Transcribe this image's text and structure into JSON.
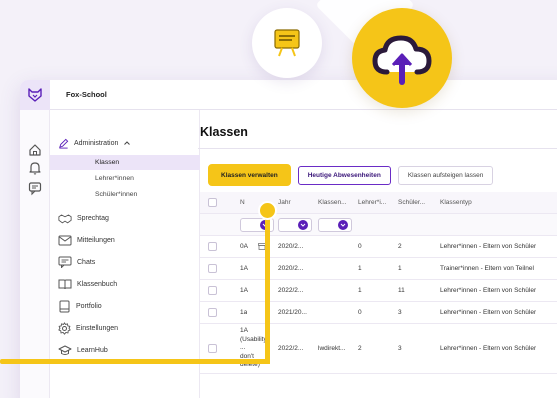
{
  "app": {
    "school_name": "Fox-School"
  },
  "sidebar": {
    "administration_label": "Administration",
    "sub_items": [
      {
        "label": "Klassen",
        "active": true
      },
      {
        "label": "Lehrer*innen",
        "active": false
      },
      {
        "label": "Schüler*innen",
        "active": false
      }
    ],
    "items": [
      {
        "label": "Sprechtag",
        "icon": "handshake-icon"
      },
      {
        "label": "Mitteilungen",
        "icon": "mail-icon"
      },
      {
        "label": "Chats",
        "icon": "chat-icon"
      },
      {
        "label": "Klassenbuch",
        "icon": "book-icon"
      },
      {
        "label": "Portfolio",
        "icon": "portfolio-icon"
      },
      {
        "label": "Einstellungen",
        "icon": "gear-icon"
      },
      {
        "label": "LearnHub",
        "icon": "graduation-cap-icon"
      }
    ]
  },
  "main": {
    "title": "Klassen",
    "buttons": {
      "manage": "Klassen verwalten",
      "absences": "Heutige Abwesenheiten",
      "promote": "Klassen aufsteigen lassen"
    }
  },
  "table": {
    "headers": {
      "name": "N",
      "year": "Jahr",
      "class": "Klassen...",
      "teachers": "Lehrer*i...",
      "students": "Schüler...",
      "type": "Klassentyp"
    },
    "rows": [
      {
        "name": "0A",
        "year": "2020/2...",
        "class": "",
        "teachers": "0",
        "students": "2",
        "type": "Lehrer*innen - Eltern von Schüler"
      },
      {
        "name": "1A",
        "year": "2020/2...",
        "class": "",
        "teachers": "1",
        "students": "1",
        "type": "Trainer*innen - Eltern von Teilnel"
      },
      {
        "name": "1A",
        "year": "2022/2...",
        "class": "",
        "teachers": "1",
        "students": "11",
        "type": "Lehrer*innen - Eltern von Schüler"
      },
      {
        "name": "1a",
        "year": "2021/20...",
        "class": "",
        "teachers": "0",
        "students": "3",
        "type": "Lehrer*innen - Eltern von Schüler"
      },
      {
        "name": "1A (Usability ... don't delete)",
        "name_lines": [
          "1A",
          "(Usability",
          "...",
          "don't",
          "delete)"
        ],
        "year": "2022/2...",
        "class": "lwdirekt...",
        "teachers": "2",
        "students": "3",
        "type": "Lehrer*innen - Eltern von Schüler"
      }
    ]
  },
  "colors": {
    "accent_yellow": "#f5c518",
    "accent_purple": "#5a1fb8",
    "active_bg": "#ece4f8"
  }
}
